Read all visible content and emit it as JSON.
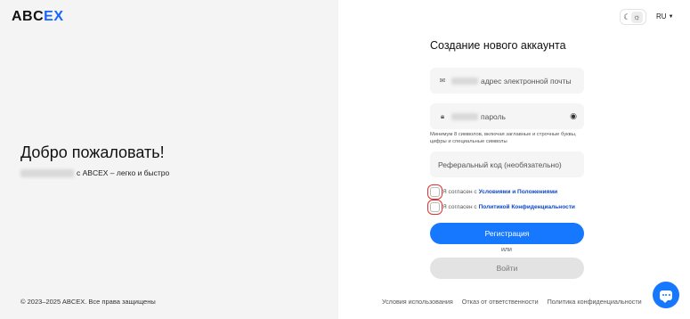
{
  "brand": {
    "logo_prefix": "ABC",
    "logo_suffix": "EX"
  },
  "left": {
    "welcome": "Добро пожаловать!",
    "tagline": "с ABCEX – легко и быстро",
    "copyright": "© 2023–2025 ABCEX. Все права защищены"
  },
  "header": {
    "language": "RU"
  },
  "form": {
    "title": "Создание нового аккаунта",
    "email_placeholder": "адрес электронной почты",
    "password_placeholder": "пароль",
    "password_hint": "Минимум 8 символов, включая заглавные и строчные буквы, цифры и специальные символы",
    "referral_placeholder": "Реферальный код (необязательно)",
    "terms_prefix": "Я согласен с",
    "terms_link": "Условиями и Положениями",
    "privacy_prefix": "Я согласен с",
    "privacy_link": "Политикой Конфиденциальности",
    "register_label": "Регистрация",
    "or_label": "или",
    "login_label": "Войти"
  },
  "footer": {
    "links": [
      "Условия использования",
      "Отказ от ответственности",
      "Политика конфиденциальности"
    ]
  },
  "colors": {
    "accent": "#1677ff",
    "link": "#0d47c7",
    "left_bg": "#f4f4f4"
  },
  "icons": {
    "theme_dark": "moon-icon",
    "theme_light": "sun-icon",
    "email": "mail-icon",
    "password": "lock-icon",
    "show_password": "eye-icon",
    "chat": "chat-icon"
  }
}
